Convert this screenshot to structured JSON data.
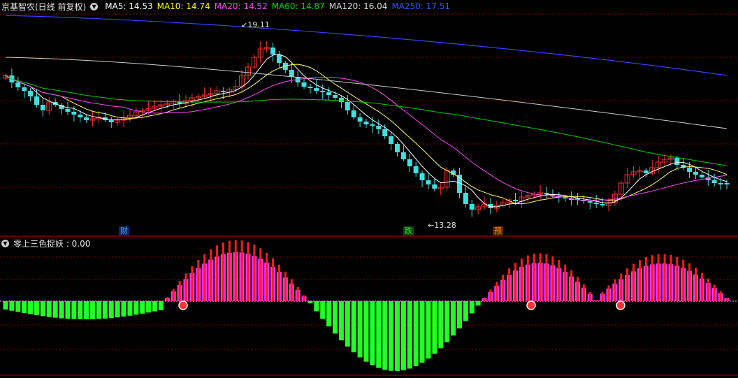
{
  "header": {
    "stock_title": "京基智农(日线 前复权)",
    "ma": [
      {
        "label": "MA5: 14.53",
        "color": "#ffffff"
      },
      {
        "label": "MA10: 14.74",
        "color": "#ffff00"
      },
      {
        "label": "MA20: 14.52",
        "color": "#ff44ff"
      },
      {
        "label": "MA60: 14.87",
        "color": "#00dd00"
      },
      {
        "label": "MA120: 16.04",
        "color": "#dddddd"
      },
      {
        "label": "MA250: 17.51",
        "color": "#3355ff"
      }
    ]
  },
  "price_panel": {
    "high_label": "19.11",
    "low_label": "13.28",
    "markers": [
      {
        "text": "财",
        "color": "#5599ff"
      },
      {
        "text": "跌",
        "color": "#33dd33"
      },
      {
        "text": "预",
        "color": "#ff8800"
      }
    ]
  },
  "indicator_panel": {
    "title": "零上三色捉妖 : 0.00"
  },
  "colors": {
    "up": "#ff3030",
    "down": "#40e0e0",
    "grid": "#8b0000",
    "hist_green": "#22ff22",
    "hist_red": "#ff1a1a",
    "hist_magenta": "#ff33ff",
    "ma5": "#ffffff",
    "ma10": "#ffff66",
    "ma20": "#ff44ff",
    "ma60": "#00cc00",
    "ma120": "#cccccc",
    "ma250": "#3344ff"
  }
}
